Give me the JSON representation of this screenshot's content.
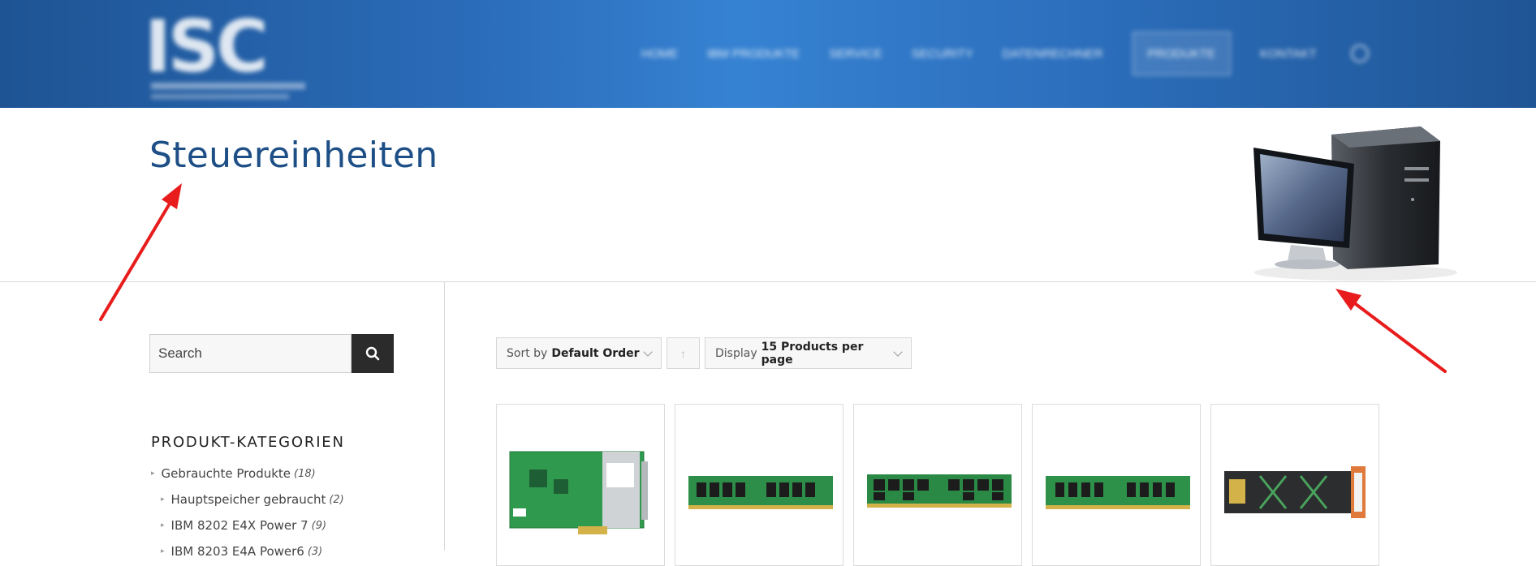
{
  "header": {
    "logo_text": "ISC",
    "nav": [
      "HOME",
      "IBM PRODUKTE",
      "SERVICE",
      "SECURITY",
      "DATENRECHNER",
      "PRODUKTE",
      "KONTAKT"
    ]
  },
  "page": {
    "title": "Steuereinheiten"
  },
  "sidebar": {
    "search_placeholder": "Search",
    "categories_title": "PRODUKT-KATEGORIEN",
    "categories": [
      {
        "label": "Gebrauchte Produkte",
        "count": "(18)"
      },
      {
        "label": "Hauptspeicher gebraucht",
        "count": "(2)"
      },
      {
        "label": "IBM 8202 E4X Power 7",
        "count": "(9)"
      },
      {
        "label": "IBM 8203 E4A Power6",
        "count": "(3)"
      }
    ]
  },
  "toolbar": {
    "sort_prefix": "Sort by",
    "sort_value": "Default Order",
    "direction_icon": "↑",
    "display_prefix": "Display",
    "display_value": "15 Products per page"
  },
  "products": [
    {
      "image": "pcie-controller-card"
    },
    {
      "image": "ram-module"
    },
    {
      "image": "ram-module"
    },
    {
      "image": "ram-module"
    },
    {
      "image": "disk-cage-module"
    }
  ],
  "colors": {
    "header_blue": "#2a6bb8",
    "title_blue": "#1d4f86",
    "annotation_red": "#e81c1c",
    "search_button": "#2b2b2b"
  }
}
